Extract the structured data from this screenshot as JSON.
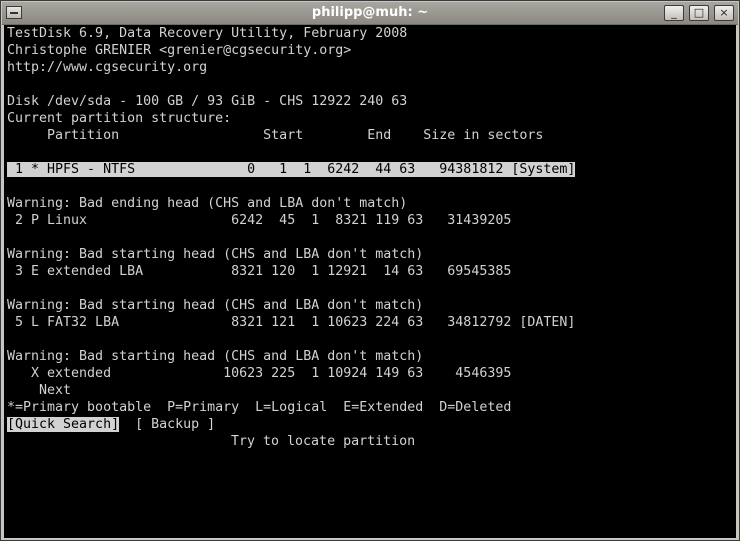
{
  "window": {
    "title": "philipp@muh: ~",
    "buttons": {
      "minimize": "_",
      "maximize": "□",
      "close": "×"
    }
  },
  "terminal": {
    "header": [
      "TestDisk 6.9, Data Recovery Utility, February 2008",
      "Christophe GRENIER <grenier@cgsecurity.org>",
      "http://www.cgsecurity.org"
    ],
    "disk": "Disk /dev/sda - 100 GB / 93 GiB - CHS 12922 240 63",
    "structure_label": "Current partition structure:",
    "column_headers": "     Partition                  Start        End    Size in sectors",
    "selected_partition": " 1 * HPFS - NTFS              0   1  1  6242  44 63   94381812 [System]",
    "warnings": [
      "Warning: Bad ending head (CHS and LBA don't match)",
      "Warning: Bad starting head (CHS and LBA don't match)",
      "Warning: Bad starting head (CHS and LBA don't match)",
      "Warning: Bad starting head (CHS and LBA don't match)"
    ],
    "partitions": [
      " 2 P Linux                  6242  45  1  8321 119 63   31439205",
      " 3 E extended LBA           8321 120  1 12921  14 63   69545385",
      " 5 L FAT32 LBA              8321 121  1 10623 224 63   34812792 [DATEN]",
      "   X extended              10623 225  1 10924 149 63    4546395"
    ],
    "next": "    Next",
    "legend": "*=Primary bootable  P=Primary  L=Logical  E=Extended  D=Deleted",
    "menu": {
      "quick_search": "[Quick Search]",
      "backup": "[ Backup ]"
    },
    "hint": "Try to locate partition"
  }
}
